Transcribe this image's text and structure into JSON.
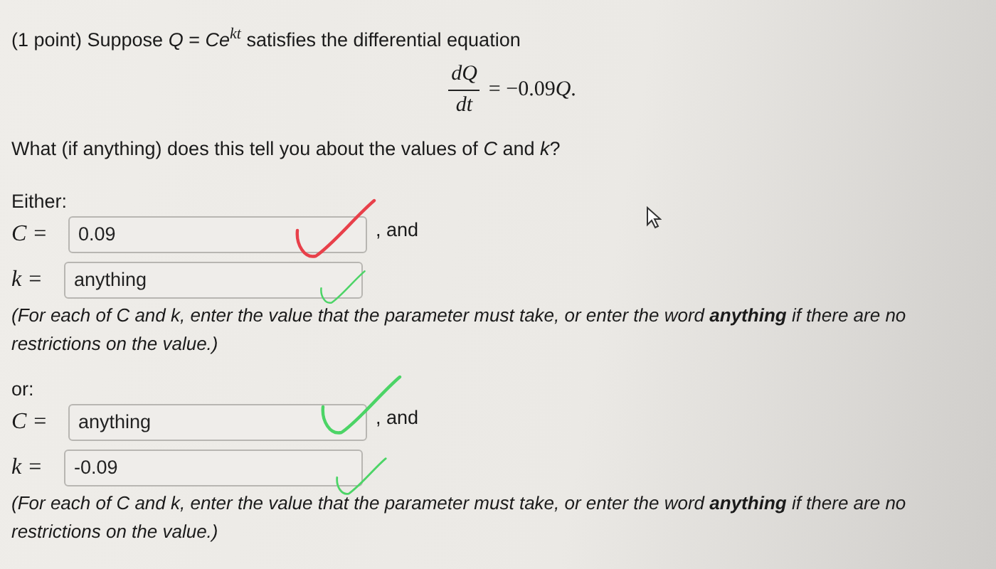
{
  "problem": {
    "intro": "(1 point) Suppose *Q* = *Ce*$^{kt}$ satisfies the differential equation",
    "equation": {
      "numerator": "dQ",
      "denominator": "dt",
      "rhs": "= −0.09",
      "rhs_variable": "Q",
      "rhs_end": "."
    },
    "question": "What (if anything) does this tell you about the values of *C* and *k*?"
  },
  "groups": [
    {
      "label": "Either:",
      "fields": [
        {
          "variable": "C =",
          "value": "0.09",
          "suffix": ", and",
          "mark": {
            "color": "#e8404a"
          }
        },
        {
          "variable": "k =",
          "value": "anything",
          "mark": {
            "color": "#4cd466"
          }
        }
      ],
      "hint": "(For each of C and k, enter the value that the parameter must take, or enter the word **anything** if there are no restrictions on the value.)"
    },
    {
      "label": "or:",
      "fields": [
        {
          "variable": "C =",
          "value": "anything",
          "suffix": ", and",
          "mark": {
            "color": "#4cd466"
          }
        },
        {
          "variable": "k =",
          "value": "-0.09",
          "mark": {
            "color": "#4cd466"
          }
        }
      ],
      "hint": "(For each of C and k, enter the value that the parameter must take, or enter the word **anything** if there are no restrictions on the value.)"
    }
  ]
}
